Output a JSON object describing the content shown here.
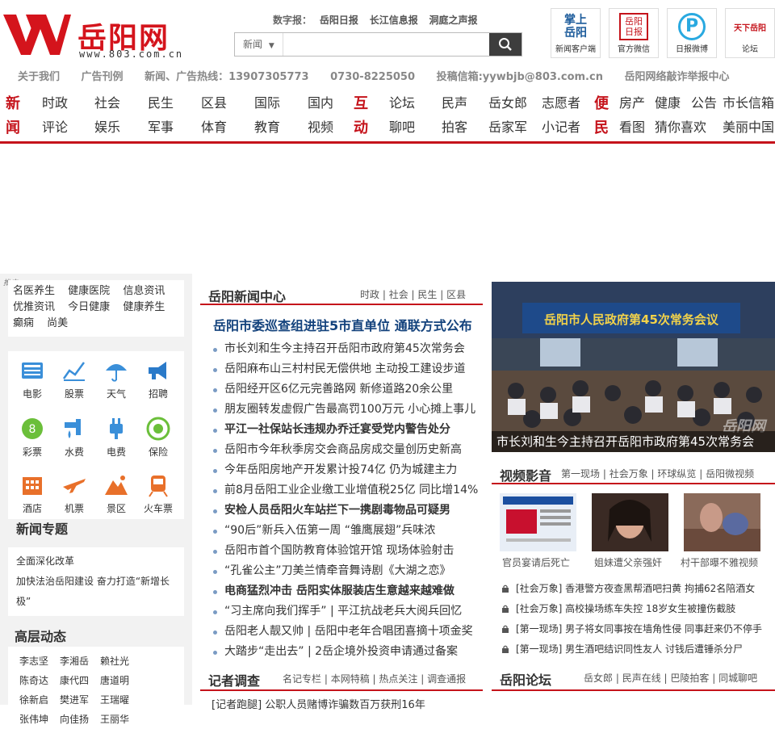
{
  "header": {
    "logo_text": "岳阳网",
    "logo_url": "www.803.com.cn",
    "digital_label": "数字报：",
    "digital_links": [
      "岳阳日报",
      "长江信息报",
      "洞庭之声报"
    ],
    "search_category": "新闻",
    "search_placeholder": "",
    "apps": [
      {
        "name": "新闻客户端",
        "pic": "掌上岳阳"
      },
      {
        "name": "官方微信",
        "pic": "岳阳日报"
      },
      {
        "name": "日报微博",
        "pic": "P"
      },
      {
        "name": "论坛",
        "pic": "天下岳阳"
      }
    ]
  },
  "info_bar": [
    "关于我们",
    "广告刊例",
    "新闻、广告热线：13907305773",
    "0730-8225050",
    "投稿信箱:yywbjb@803.com.cn",
    "岳阳网络敲诈举报中心"
  ],
  "nav": {
    "sections": [
      {
        "head": "新闻",
        "rows": [
          [
            "时政",
            "社会",
            "民生",
            "区县",
            "国际",
            "国内"
          ],
          [
            "评论",
            "娱乐",
            "军事",
            "体育",
            "教育",
            "视频"
          ]
        ]
      },
      {
        "head": "互动",
        "rows": [
          [
            "论坛",
            "民声",
            "岳女郎",
            "志愿者"
          ],
          [
            "聊吧",
            "拍客",
            "岳家军",
            "小记者"
          ]
        ]
      },
      {
        "head": "便民",
        "rows": [
          [
            "房产",
            "健康",
            "公告",
            "市长信箱"
          ],
          [
            "看图",
            "猜你喜欢",
            "美丽中国"
          ]
        ]
      }
    ]
  },
  "left": {
    "tui": "推广",
    "health_links": [
      "名医养生",
      "健康医院",
      "信息资讯",
      "优推资讯",
      "今日健康",
      "健康养生",
      "癫痫",
      "尚美"
    ],
    "services": [
      {
        "label": "电影",
        "icon": "movie-icon"
      },
      {
        "label": "股票",
        "icon": "stock-icon"
      },
      {
        "label": "天气",
        "icon": "weather-icon"
      },
      {
        "label": "招聘",
        "icon": "recruit-icon"
      },
      {
        "label": "彩票",
        "icon": "lottery-icon"
      },
      {
        "label": "水费",
        "icon": "water-icon"
      },
      {
        "label": "电费",
        "icon": "power-icon"
      },
      {
        "label": "保险",
        "icon": "insurance-icon"
      },
      {
        "label": "酒店",
        "icon": "hotel-icon"
      },
      {
        "label": "机票",
        "icon": "plane-icon"
      },
      {
        "label": "景区",
        "icon": "scenic-icon"
      },
      {
        "label": "火车票",
        "icon": "train-icon"
      }
    ],
    "special_title": "新闻专题",
    "special_items": [
      "全面深化改革",
      "加快法治岳阳建设 奋力打造“新增长极”"
    ],
    "leaders_title": "高层动态",
    "leaders": [
      "李志坚",
      "李湘岳",
      "赖社光",
      "陈奇达",
      "康代四",
      "唐道明",
      "徐新启",
      "樊进军",
      "王瑞曜",
      "张伟坤",
      "向佳扬",
      "王丽华"
    ]
  },
  "middle": {
    "title": "岳阳新闻中心",
    "tabs": [
      "时政",
      "社会",
      "民生",
      "区县"
    ],
    "headline": "岳阳市委巡查组进驻5市直单位 通联方式公布",
    "news": [
      {
        "t": "市长刘和生今主持召开岳阳市政府第45次常务会",
        "b": false
      },
      {
        "t": "岳阳麻布山三村村民无偿供地 主动投工建设步道",
        "b": false
      },
      {
        "t": "岳阳经开区6亿元完善路网 新修道路20余公里",
        "b": false
      },
      {
        "t": "朋友圈转发虚假广告最高罚100万元 小心摊上事儿",
        "b": false
      },
      {
        "t": "平江一社保站长违规办乔迁宴受党内警告处分",
        "b": true
      },
      {
        "t": "岳阳市今年秋季房交会商品房成交量创历史新高",
        "b": false
      },
      {
        "t": "今年岳阳房地产开发累计投74亿 仍为城建主力",
        "b": false
      },
      {
        "t": "前8月岳阳工业企业缴工业增值税25亿 同比增14%",
        "b": false
      },
      {
        "t": "安检人员岳阳火车站拦下一携剧毒物品可疑男",
        "b": true
      },
      {
        "t": "“90后”新兵入伍第一周 “雏鹰展翅”兵味浓",
        "b": false
      },
      {
        "t": "岳阳市首个国防教育体验馆开馆 现场体验射击",
        "b": false
      },
      {
        "t": "“孔雀公主”刀美兰情牵音舞诗剧《大湖之恋》",
        "b": false
      },
      {
        "t": "电商猛烈冲击 岳阳实体服装店生意越来越难做",
        "b": true
      },
      {
        "t": "“习主席向我们挥手” | 平江抗战老兵大阅兵回忆",
        "b": false
      },
      {
        "t": "岳阳老人靓又帅 | 岳阳中老年合唱团喜摘十项金奖",
        "b": false
      },
      {
        "t": "大踏步“走出去” | 2岳企境外投资申请通过备案",
        "b": false
      }
    ],
    "jizhe_title": "记者调查",
    "jizhe_tabs": [
      "名记专栏",
      "本网特稿",
      "热点关注",
      "调查通报"
    ],
    "jizhe_first": "[记者跑腿] 公职人员赌博诈骗数百万获刑16年"
  },
  "right": {
    "big_photo_banner": "岳阳市人民政府第45次常务会议",
    "big_caption": "市长刘和生今主持召开岳阳市政府第45次常务会",
    "watermark": "岳阳网",
    "video_title": "视频影音",
    "video_tabs": [
      "第一现场",
      "社会万象",
      "环球纵览",
      "岳阳微视频"
    ],
    "video_caps": [
      "官员宴请后死亡",
      "姐妹遭父亲强奸",
      "村干部曝不雅视频"
    ],
    "video_list": [
      "[社会万象] 香港警方夜查黑帮酒吧扫黄 拘捕62名陪酒女",
      "[社会万象] 高校操场练车失控 18岁女生被撞伤截肢",
      "[第一现场] 男子将女同事按在墙角性侵 同事赶来仍不停手",
      "[第一现场] 男生酒吧结识同性友人 讨钱后遭锤杀分尸"
    ],
    "forum_title": "岳阳论坛",
    "forum_tabs": [
      "岳女郎",
      "民声在线",
      "巴陵拍客",
      "同城聊吧"
    ]
  },
  "colors": {
    "brand_red": "#c5131b",
    "link_blue": "#13427c"
  }
}
